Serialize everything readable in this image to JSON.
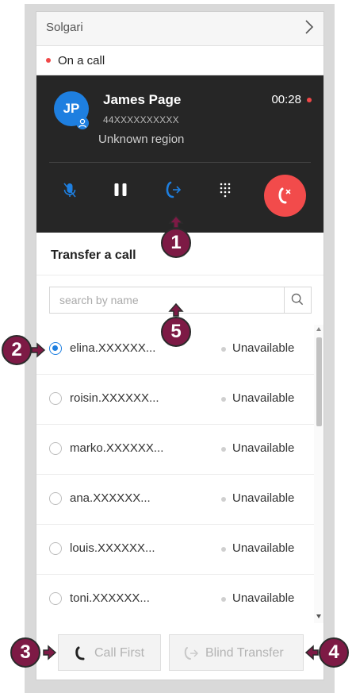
{
  "header": {
    "title": "Solgari"
  },
  "status": {
    "text": "On a call"
  },
  "call": {
    "initials": "JP",
    "name": "James Page",
    "number": "44XXXXXXXXXX",
    "region": "Unknown region",
    "timer": "00:28"
  },
  "transfer": {
    "title": "Transfer a call",
    "search_placeholder": "search by name",
    "contacts": [
      {
        "name": "elina.XXXXXX...",
        "status": "Unavailable",
        "selected": true
      },
      {
        "name": "roisin.XXXXXX...",
        "status": "Unavailable",
        "selected": false
      },
      {
        "name": "marko.XXXXXX...",
        "status": "Unavailable",
        "selected": false
      },
      {
        "name": "ana.XXXXXX...",
        "status": "Unavailable",
        "selected": false
      },
      {
        "name": "louis.XXXXXX...",
        "status": "Unavailable",
        "selected": false
      },
      {
        "name": "toni.XXXXXX...",
        "status": "Unavailable",
        "selected": false
      }
    ]
  },
  "footer": {
    "call_first_label": "Call First",
    "blind_transfer_label": "Blind Transfer"
  },
  "callouts": [
    "1",
    "2",
    "3",
    "4",
    "5"
  ],
  "icons": {
    "header": "chevron-right-icon",
    "controls": [
      "mute-icon",
      "pause-icon",
      "transfer-icon",
      "dialpad-icon",
      "end-call-icon"
    ],
    "search": "search-icon",
    "footer": [
      "phone-icon",
      "blind-transfer-icon"
    ]
  },
  "colors": {
    "accent": "#1e7fe0",
    "end_call": "#f24b4b",
    "call_card": "#262626",
    "callout": "#7d1a45"
  }
}
